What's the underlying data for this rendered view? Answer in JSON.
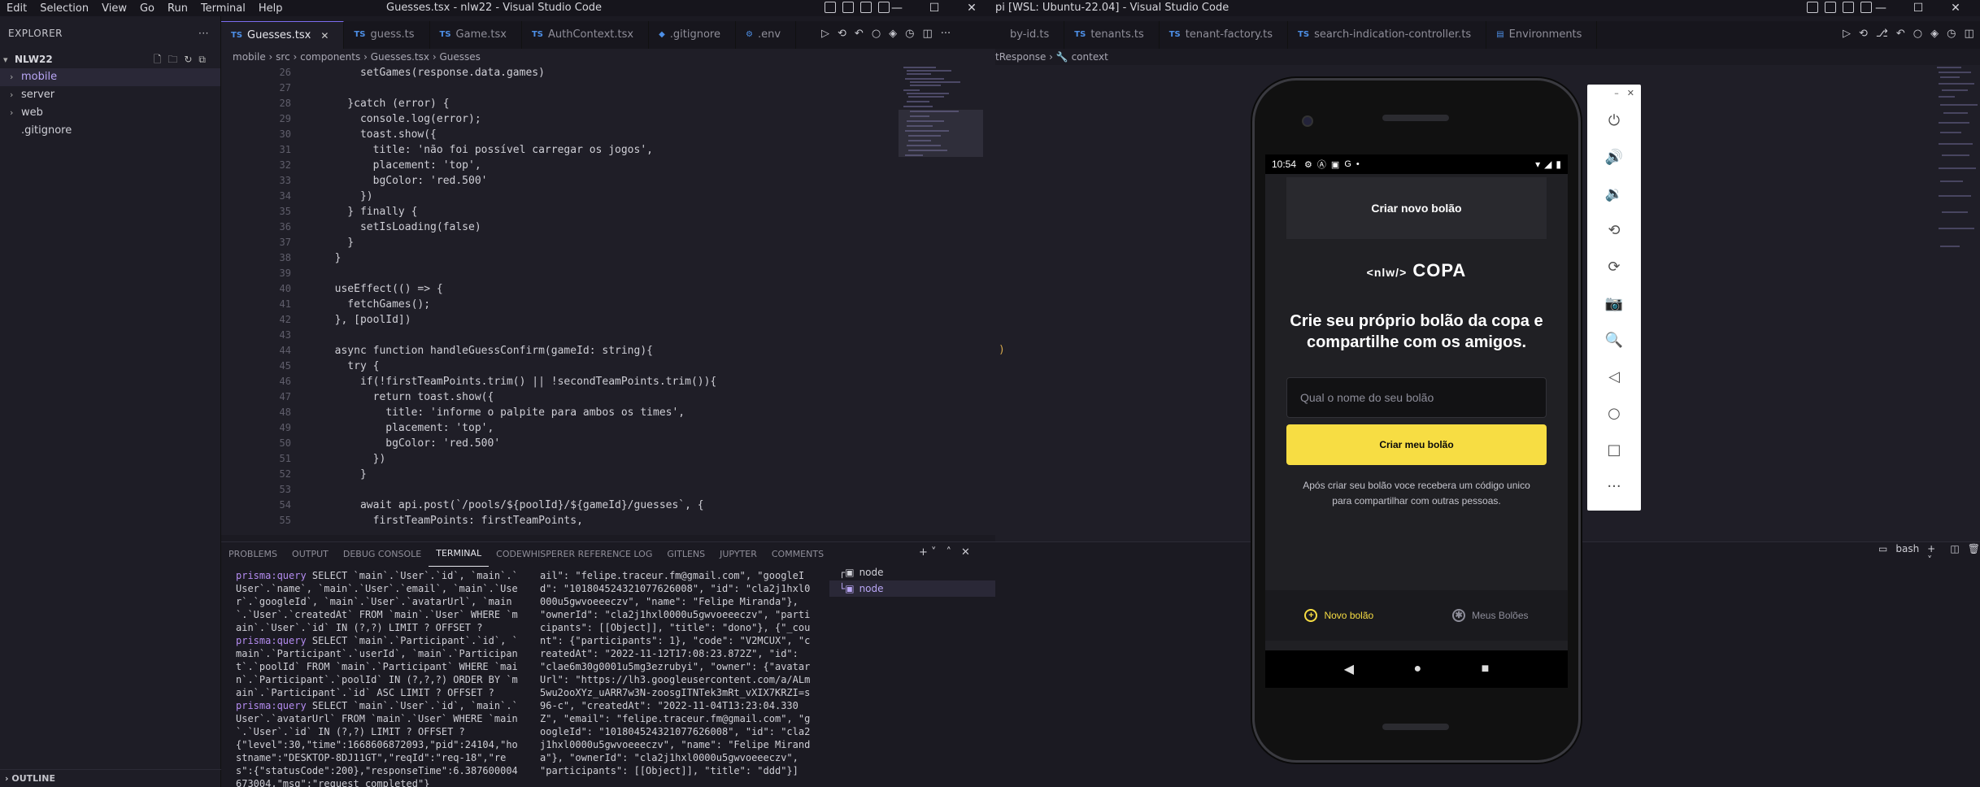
{
  "left_window": {
    "menu": [
      "Edit",
      "Selection",
      "View",
      "Go",
      "Run",
      "Terminal",
      "Help"
    ],
    "title": "Guesses.tsx - nlw22 - Visual Studio Code",
    "explorer": {
      "header": "EXPLORER",
      "root": "NLW22",
      "items": [
        "mobile",
        "server",
        "web",
        ".gitignore"
      ],
      "outline": "OUTLINE"
    },
    "tabs": [
      {
        "badge": "TS",
        "label": "Guesses.tsx"
      },
      {
        "badge": "TS",
        "label": "guess.ts"
      },
      {
        "badge": "TS",
        "label": "Game.tsx"
      },
      {
        "badge": "TS",
        "label": "AuthContext.tsx"
      },
      {
        "badge": "◆",
        "label": ".gitignore"
      },
      {
        "badge": "⚙",
        "label": ".env"
      }
    ],
    "breadcrumb": [
      "mobile",
      "src",
      "components",
      "Guesses.tsx",
      "Guesses"
    ],
    "code_lines": [
      {
        "n": "26",
        "t": "      setGames(response.data.games)"
      },
      {
        "n": "27",
        "t": ""
      },
      {
        "n": "28",
        "t": "    }catch (error) {"
      },
      {
        "n": "29",
        "t": "      console.log(error);"
      },
      {
        "n": "30",
        "t": "      toast.show({"
      },
      {
        "n": "31",
        "t": "        title: 'não foi possível carregar os jogos',"
      },
      {
        "n": "32",
        "t": "        placement: 'top',"
      },
      {
        "n": "33",
        "t": "        bgColor: 'red.500'"
      },
      {
        "n": "34",
        "t": "      })"
      },
      {
        "n": "35",
        "t": "    } finally {"
      },
      {
        "n": "36",
        "t": "      setIsLoading(false)"
      },
      {
        "n": "37",
        "t": "    }"
      },
      {
        "n": "38",
        "t": "  }"
      },
      {
        "n": "39",
        "t": ""
      },
      {
        "n": "40",
        "t": "  useEffect(() => {"
      },
      {
        "n": "41",
        "t": "    fetchGames();"
      },
      {
        "n": "42",
        "t": "  }, [poolId])"
      },
      {
        "n": "43",
        "t": ""
      },
      {
        "n": "44",
        "t": "  async function handleGuessConfirm(gameId: string){"
      },
      {
        "n": "45",
        "t": "    try {"
      },
      {
        "n": "46",
        "t": "      if(!firstTeamPoints.trim() || !secondTeamPoints.trim()){"
      },
      {
        "n": "47",
        "t": "        return toast.show({"
      },
      {
        "n": "48",
        "t": "          title: 'informe o palpite para ambos os times',"
      },
      {
        "n": "49",
        "t": "          placement: 'top',"
      },
      {
        "n": "50",
        "t": "          bgColor: 'red.500'"
      },
      {
        "n": "51",
        "t": "        })"
      },
      {
        "n": "52",
        "t": "      }"
      },
      {
        "n": "53",
        "t": ""
      },
      {
        "n": "54",
        "t": "      await api.post(`/pools/${poolId}/${gameId}/guesses`, {"
      },
      {
        "n": "55",
        "t": "        firstTeamPoints: firstTeamPoints,"
      }
    ],
    "panel_tabs": [
      "PROBLEMS",
      "OUTPUT",
      "DEBUG CONSOLE",
      "TERMINAL",
      "CODEWHISPERER REFERENCE LOG",
      "GITLENS",
      "JUPYTER",
      "COMMENTS"
    ],
    "terminal_left": [
      {
        "prefix": "prisma:query",
        "text": " SELECT `main`.`User`.`id`, `main`.`User`.`name`, `main`.`User`.`email`, `main`.`User`.`googleId`, `main`.`User`.`avatarUrl`, `main`.`User`.`createdAt` FROM `main`.`User` WHERE `main`.`User`.`id` IN (?,?) LIMIT ? OFFSET ?"
      },
      {
        "prefix": "prisma:query",
        "text": " SELECT `main`.`Participant`.`id`, `main`.`Participant`.`userId`, `main`.`Participant`.`poolId` FROM `main`.`Participant` WHERE `main`.`Participant`.`poolId` IN (?,?,?) ORDER BY `main`.`Participant`.`id` ASC LIMIT ? OFFSET ?"
      },
      {
        "prefix": "prisma:query",
        "text": " SELECT `main`.`User`.`id`, `main`.`User`.`avatarUrl` FROM `main`.`User` WHERE `main`.`User`.`id` IN (?,?) LIMIT ? OFFSET ?"
      },
      {
        "prefix": "",
        "text": "{\"level\":30,\"time\":1668606872093,\"pid\":24104,\"hostname\":\"DESKTOP-8DJ11GT\",\"reqId\":\"req-18\",\"res\":{\"statusCode\":200},\"responseTime\":6.387600004673004,\"msg\":\"request completed\"}"
      }
    ],
    "terminal_right": "ail\": \"felipe.traceur.fm@gmail.com\", \"googleId\": \"101804524321077626008\", \"id\": \"cla2j1hxl0000u5gwvoeeeczv\", \"name\": \"Felipe Miranda\"}, \"ownerId\": \"cla2j1hxl0000u5gwvoeeeczv\", \"participants\": [[Object]], \"title\": \"dono\"}, {\"_count\": {\"participants\": 1}, \"code\": \"V2MCUX\", \"createdAt\": \"2022-11-12T17:08:23.872Z\", \"id\": \"clae6m30g0001u5mg3ezrubyi\", \"owner\": {\"avatarUrl\": \"https://lh3.googleusercontent.com/a/ALm5wu2ooXYz_uARR7w3N-zoosgITNTek3mRt_vXIX7KRZI=s96-c\", \"createdAt\": \"2022-11-04T13:23:04.330Z\", \"email\": \"felipe.traceur.fm@gmail.com\", \"googleId\": \"101804524321077626008\", \"id\": \"cla2j1hxl0000u5gwvoeeeczv\", \"name\": \"Felipe Miranda\"}, \"ownerId\": \"cla2j1hxl0000u5gwvoeeeczv\", \"participants\": [[Object]], \"title\": \"ddd\"}]",
    "terminals": [
      "node",
      "node"
    ]
  },
  "right_window": {
    "title": "pi [WSL: Ubuntu-22.04] - Visual Studio Code",
    "tabs": [
      {
        "badge": "",
        "label": "by-id.ts"
      },
      {
        "badge": "TS",
        "label": "tenants.ts"
      },
      {
        "badge": "TS",
        "label": "tenant-factory.ts"
      },
      {
        "badge": "TS",
        "label": "search-indication-controller.ts"
      },
      {
        "badge": "▤",
        "label": "Environments"
      }
    ],
    "breadcrumb": [
      "tResponse",
      "context"
    ],
    "bash_label": "bash"
  },
  "phone": {
    "time": "10:54",
    "header_button": "Criar novo bolão",
    "logo_small": "<nlw/>",
    "logo_big": "COPA",
    "headline": "Crie seu próprio bolão da copa e compartilhe com os amigos.",
    "input_placeholder": "Qual o nome do seu bolão",
    "create_button": "Criar meu bolão",
    "help_text": "Após criar seu bolão voce recebera um código unico para compartilhar com outras pessoas.",
    "nav": [
      {
        "label": "Novo bolão",
        "color": "#f7dd43"
      },
      {
        "label": "Meus Bolões",
        "color": "#8d8d99"
      }
    ]
  },
  "colors": {
    "accent_yellow": "#f7dd43",
    "editor_bg": "#1f1e27",
    "active_tab_border": "#7b6cf0"
  }
}
